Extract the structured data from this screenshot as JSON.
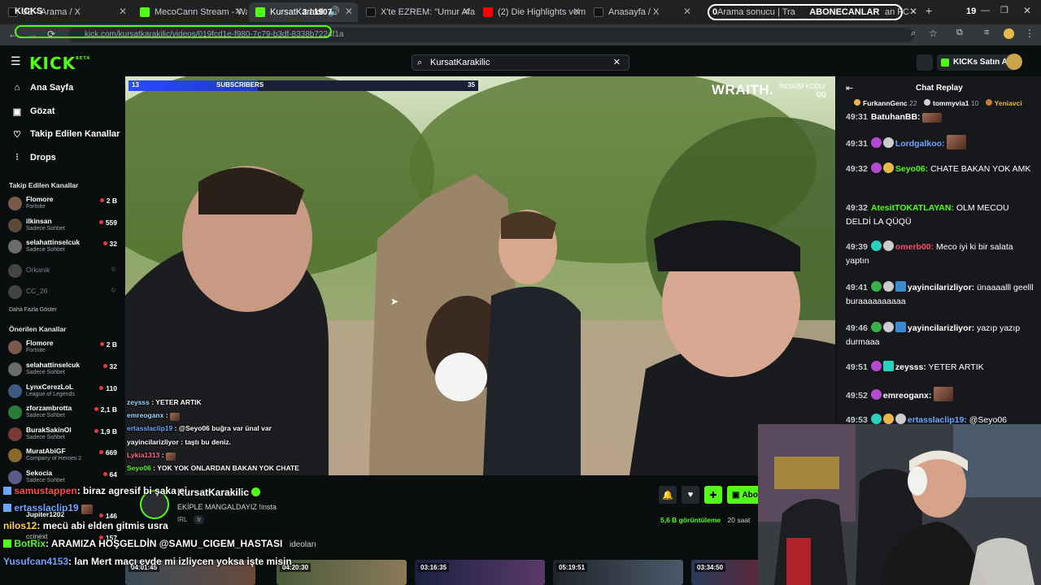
{
  "browser": {
    "tabs": [
      {
        "label": "JE - Arama / X",
        "favicon_color": "#111111"
      },
      {
        "label": "MecoCann Stream - Watc",
        "favicon_color": "#53fc18"
      },
      {
        "label": "KursatKarakil",
        "favicon_color": "#53fc18"
      },
      {
        "label": "X'te EZREM: \"Umur Afan S",
        "favicon_color": "#111111"
      },
      {
        "label": "(2) Die Highlights vom 45.",
        "favicon_color": "#ff0000"
      },
      {
        "label": "Anasayfa / X",
        "favicon_color": "#111111"
      },
      {
        "label": "Arama sonucu | Transferm",
        "favicon_color": "#2b5fd9"
      },
      {
        "label": "an FC -",
        "favicon_color": "#2b5fd9"
      }
    ],
    "url": "kick.com/kursatkarakilic/videos/019fcd1e-f980-7c79-b3df-8338b7224f1a",
    "tab_count": "19"
  },
  "stream_overlay": {
    "kicks_label": "KICKS",
    "counter": "3 / 1907",
    "abone_count": "0",
    "abone_label": "ABONECANLAR",
    "subscribers_current": "13",
    "subscribers_label": "SUBSCRIBERS",
    "subscribers_goal": "35",
    "subscribers_progress": 0.37,
    "sponsor": "WRAITH.",
    "sponsor_code_label": "İNDİRİM KODU:",
    "sponsor_code": "QQ"
  },
  "kick_nav": {
    "logo": "KICK",
    "logo_badge": "BETA",
    "search_value": "KursatKarakilic",
    "buy_kicks_label": "KICKs Satın Al"
  },
  "sidebar": {
    "nav": [
      {
        "label": "Ana Sayfa",
        "icon": "home-icon"
      },
      {
        "label": "Gözat",
        "icon": "browse-icon"
      },
      {
        "label": "Takip Edilen Kanallar",
        "icon": "heart-icon"
      },
      {
        "label": "Drops",
        "icon": "drops-icon"
      }
    ],
    "followed_title": "Takip Edilen Kanallar",
    "followed": [
      {
        "name": "Flomore",
        "category": "Fortnite",
        "viewers": "2 B",
        "avatar": "#7a5a4a",
        "live": true
      },
      {
        "name": "ilkinsan",
        "category": "Sadece Sohbet",
        "viewers": "559",
        "avatar": "#5a4a3a",
        "live": true
      },
      {
        "name": "selahattinselcuk",
        "category": "Sadece Sohbet",
        "viewers": "32",
        "avatar": "#6b6b6b",
        "live": true
      },
      {
        "name": "Orkanik",
        "category": "",
        "viewers": "",
        "avatar": "#444444",
        "live": false
      },
      {
        "name": "CC_26",
        "category": "",
        "viewers": "",
        "avatar": "#444444",
        "live": false
      }
    ],
    "show_more": "Daha Fazla Göster",
    "recommended_title": "Önerilen Kanallar",
    "recommended": [
      {
        "name": "Flomore",
        "category": "Fortnite",
        "viewers": "2 B",
        "avatar": "#7a5a4a"
      },
      {
        "name": "selahattinselcuk",
        "category": "Sadece Sohbet",
        "viewers": "32",
        "avatar": "#6b6b6b"
      },
      {
        "name": "LynxCerezLoL",
        "category": "League of Legends",
        "viewers": "110",
        "avatar": "#3d5a80"
      },
      {
        "name": "zforzambrotta",
        "category": "Sadece Sohbet",
        "viewers": "2,1 B",
        "avatar": "#2a7a3a"
      },
      {
        "name": "BurakSakinOl",
        "category": "Sadece Sohbet",
        "viewers": "1,9 B",
        "avatar": "#7a3a3a"
      },
      {
        "name": "MuratAbiGF",
        "category": "Company of Heroes 2",
        "viewers": "669",
        "avatar": "#8a6a2a"
      },
      {
        "name": "Sekocia",
        "category": "Sadece Sohbet",
        "viewers": "64",
        "avatar": "#5a5a8a"
      },
      {
        "name": "Jupiter1202",
        "category": "",
        "viewers": "146",
        "avatar": "#5a5a5a"
      },
      {
        "name": "ccinext",
        "category": "",
        "viewers": "157",
        "avatar": "#5a5a5a"
      }
    ]
  },
  "video_chat_overlay": [
    {
      "user": "zeysss",
      "text": "YETER ARTIK",
      "color": "#9fd7ff"
    },
    {
      "user": "emreoganx",
      "text": "",
      "color": "#9fd7ff"
    },
    {
      "user": "ertasslaclip19",
      "text": "@Seyo06 buğra var ünal var",
      "color": "#6ea6ff"
    },
    {
      "user": "yayincilarizliyor",
      "text": "taştı bu deniz.",
      "color": "#ffffff"
    },
    {
      "user": "Lykia1313",
      "text": "",
      "color": "#ff6b8a"
    },
    {
      "user": "Seyo06",
      "text": "YOK YOK ONLARDAN BAKAN YOK CHATE",
      "color": "#53fc18"
    }
  ],
  "streamer_chat": [
    {
      "user": "samustappen",
      "text": ": biraz agresif bi şaka ei",
      "color": "#ff4a4a"
    },
    {
      "user": "ertasslaclip19",
      "text": "",
      "color": "#6ea6ff"
    },
    {
      "user": "nilos12",
      "text": ": mecü abi elden gitmis usra",
      "color": "#ffd23f"
    },
    {
      "user": "BotRix",
      "text": ": ARAMIZA HOŞGELDİN @SAMU_CIGEM_HASTASI",
      "color": "#53fc18"
    },
    {
      "user": "Yusufcan4153",
      "text": ": lan Mert maçı evde mi izliycen yoksa işte misin",
      "color": "#6ea6ff"
    }
  ],
  "stream_info": {
    "channel": "KursatKarakilic",
    "title": "EKİPLE MANGALDAYIZ !insta",
    "category": "IRL",
    "language": "tr",
    "views": "5,6 B görüntüleme",
    "time": "20 saat",
    "follow_label": "Abone",
    "videos_label": "ideoları"
  },
  "thumbnails": [
    {
      "duration": "04:01:45"
    },
    {
      "duration": "04:20:30"
    },
    {
      "duration": "03:16:35"
    },
    {
      "duration": "05:19:51"
    },
    {
      "duration": "03:34:50"
    }
  ],
  "chat": {
    "title": "Chat Replay",
    "pinned": [
      {
        "user": "FurkannGenc",
        "count": "22"
      },
      {
        "user": "tommyvia1",
        "count": "10"
      },
      {
        "user": "Yeniavci",
        "count": ""
      }
    ],
    "messages": [
      {
        "time": "49:31",
        "user": "BatuhanBB:",
        "text": "",
        "color": "#ffffff",
        "emote": true
      },
      {
        "time": "49:31",
        "user": "Lordgalkoo:",
        "text": "",
        "color": "#6ea6ff",
        "emote": true
      },
      {
        "time": "49:32",
        "user": "Seyo06:",
        "text": "CHATE BAKAN YOK AMK",
        "color": "#53fc18",
        "emote": false
      },
      {
        "time": "49:32",
        "user": "AtesitTOKATLAYAN:",
        "text": "OLM MECOU DELDİ LA QÜQÜ",
        "color": "#53fc18",
        "emote": false
      },
      {
        "time": "49:39",
        "user": "omerb00:",
        "text": "Meco iyi ki bir salata yaptın",
        "color": "#ff4a6a",
        "emote": false
      },
      {
        "time": "49:41",
        "user": "yayincilarizliyor:",
        "text": "ünaaaalll geelll buraaaaaaaaaa",
        "color": "#ffffff",
        "emote": false
      },
      {
        "time": "49:46",
        "user": "yayincilarizliyor:",
        "text": "yazıp yazıp durmaaa",
        "color": "#ffffff",
        "emote": false
      },
      {
        "time": "49:51",
        "user": "zeysss:",
        "text": "YETER ARTIK",
        "color": "#ffffff",
        "emote": false
      },
      {
        "time": "49:52",
        "user": "emreoganx:",
        "text": "",
        "color": "#ffffff",
        "emote": true
      },
      {
        "time": "49:53",
        "user": "ertasslaclip19:",
        "text": "@Seyo06",
        "color": "#6ea6ff",
        "emote": false
      }
    ]
  }
}
